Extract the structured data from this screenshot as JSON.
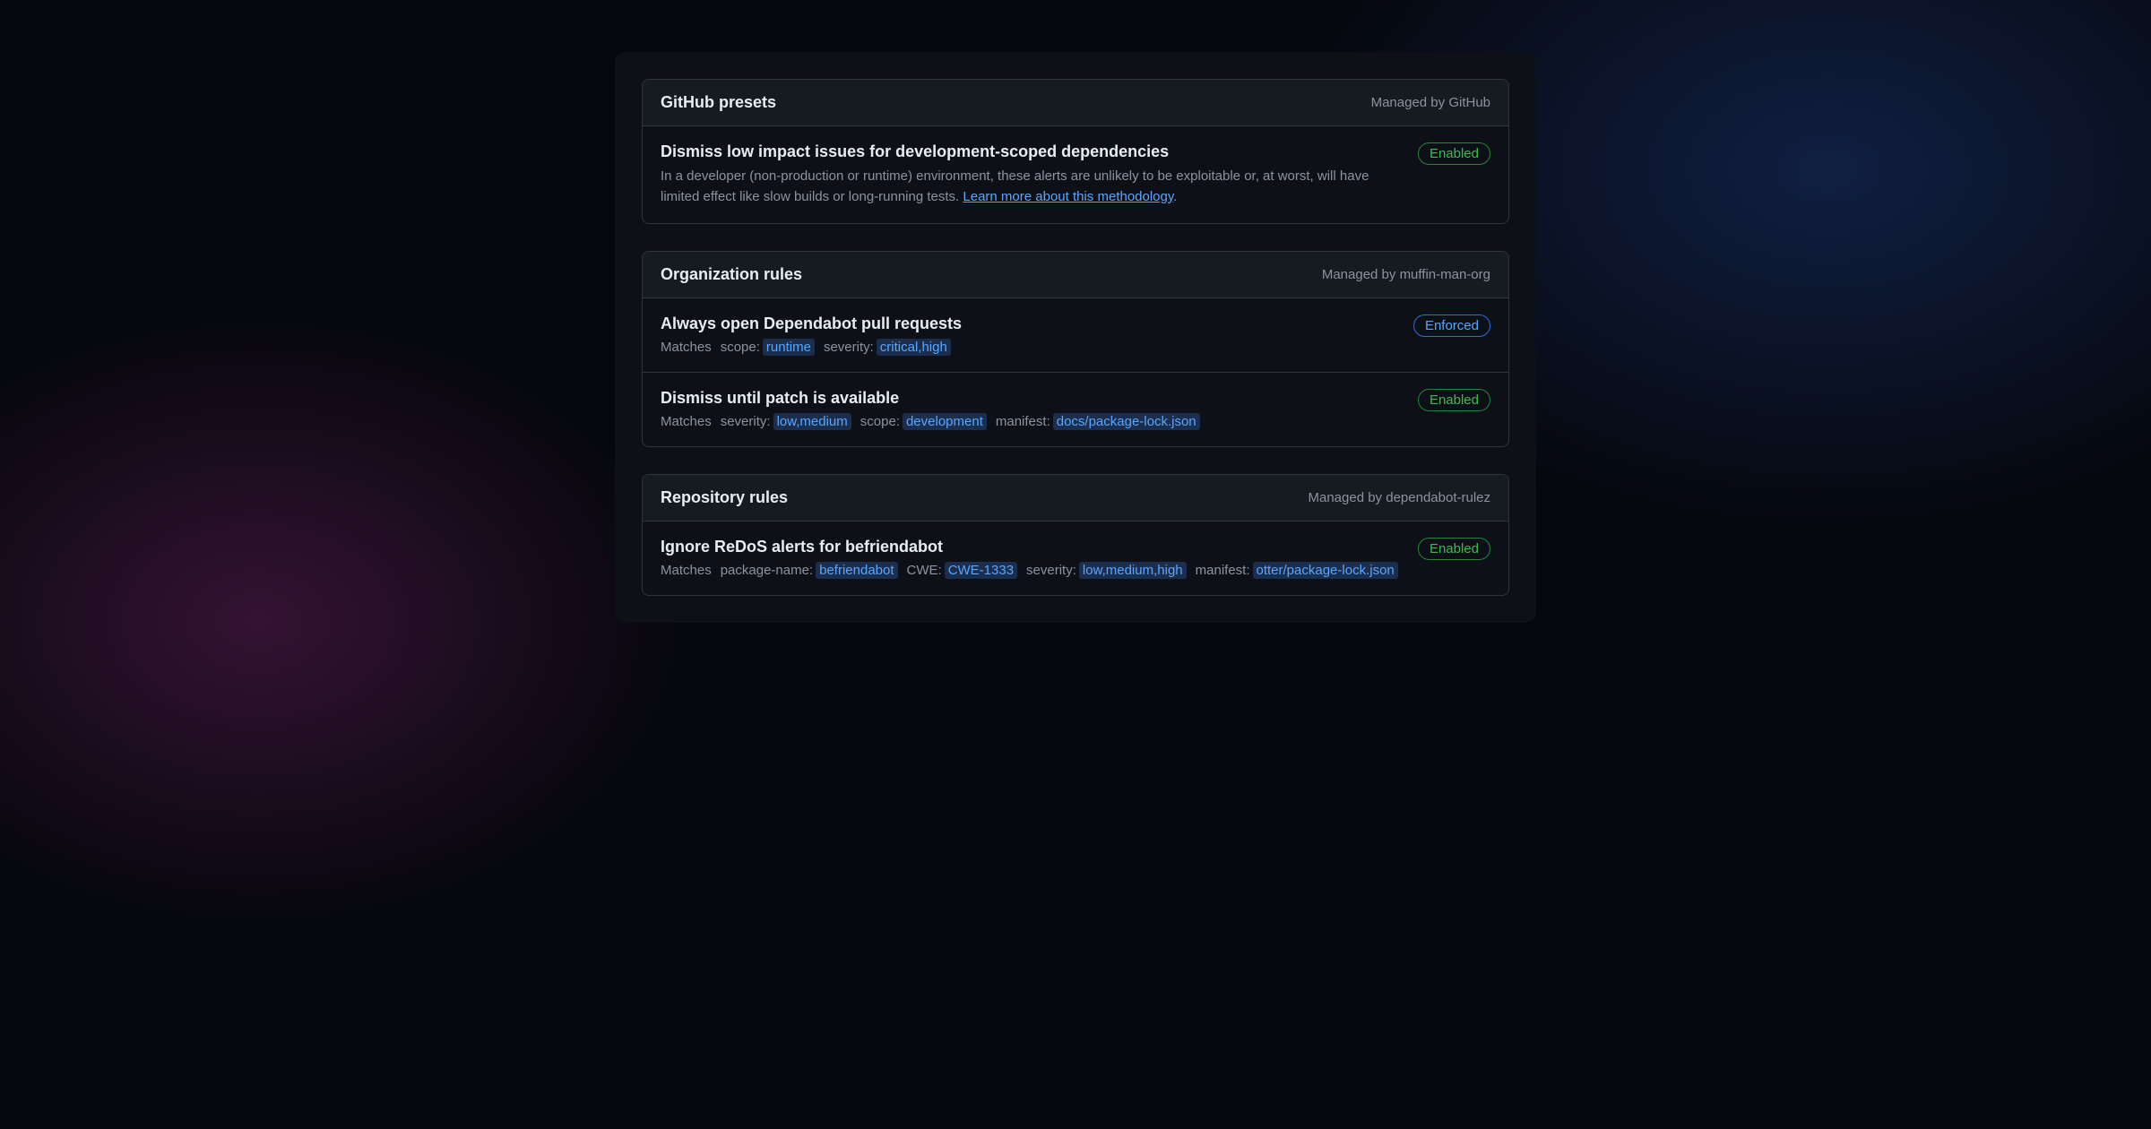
{
  "labels": {
    "managed_by": "Managed by",
    "matches": "Matches"
  },
  "sections": [
    {
      "title": "GitHub presets",
      "managed_by": "GitHub",
      "rules": [
        {
          "title": "Dismiss low impact issues for development-scoped dependencies",
          "description": "In a developer (non-production or runtime) environment, these alerts are unlikely to be exploitable or, at worst, will have limited effect like slow builds or long-running tests.",
          "learn_more": "Learn more about this methodology",
          "badge": {
            "text": "Enabled",
            "variant": "enabled"
          },
          "match_groups": []
        }
      ]
    },
    {
      "title": "Organization rules",
      "managed_by": "muffin-man-org",
      "rules": [
        {
          "title": "Always open Dependabot pull requests",
          "badge": {
            "text": "Enforced",
            "variant": "enforced"
          },
          "match_groups": [
            {
              "key": "scope:",
              "value": "runtime"
            },
            {
              "key": "severity:",
              "value": "critical,high"
            }
          ]
        },
        {
          "title": "Dismiss until patch is available",
          "badge": {
            "text": "Enabled",
            "variant": "enabled"
          },
          "match_groups": [
            {
              "key": "severity:",
              "value": "low,medium"
            },
            {
              "key": "scope:",
              "value": "development"
            },
            {
              "key": "manifest:",
              "value": "docs/package-lock.json"
            }
          ]
        }
      ]
    },
    {
      "title": "Repository rules",
      "managed_by": "dependabot-rulez",
      "rules": [
        {
          "title": "Ignore ReDoS alerts for befriendabot",
          "badge": {
            "text": "Enabled",
            "variant": "enabled"
          },
          "match_groups": [
            {
              "key": "package-name:",
              "value": "befriendabot"
            },
            {
              "key": "CWE:",
              "value": "CWE-1333"
            },
            {
              "key": "severity:",
              "value": "low,medium,high"
            },
            {
              "key": "manifest:",
              "value": "otter/package-lock.json"
            }
          ]
        }
      ]
    }
  ]
}
